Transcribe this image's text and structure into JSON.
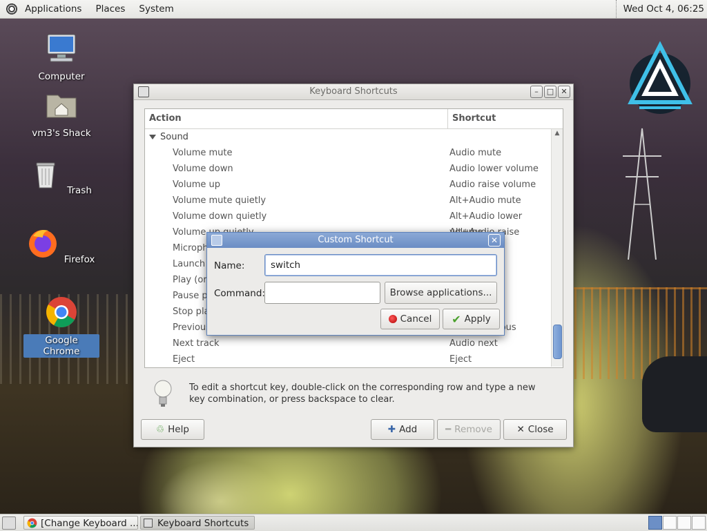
{
  "top_panel": {
    "menus": [
      "Applications",
      "Places",
      "System"
    ],
    "clock": "Wed Oct  4, 06:25"
  },
  "desktop_icons": [
    {
      "label": "Computer",
      "icon": "computer-icon"
    },
    {
      "label": "vm3's Shack",
      "icon": "home-folder-icon"
    },
    {
      "label": "Trash",
      "icon": "trash-icon"
    },
    {
      "label": "Firefox",
      "icon": "firefox-icon"
    },
    {
      "label": "Google Chrome",
      "icon": "chrome-icon"
    }
  ],
  "main_window": {
    "title": "Keyboard Shortcuts",
    "columns": {
      "action": "Action",
      "shortcut": "Shortcut"
    },
    "group": "Sound",
    "rows": [
      {
        "action": "Volume mute",
        "shortcut": "Audio mute"
      },
      {
        "action": "Volume down",
        "shortcut": "Audio lower volume"
      },
      {
        "action": "Volume up",
        "shortcut": "Audio raise volume"
      },
      {
        "action": "Volume mute quietly",
        "shortcut": "Alt+Audio mute"
      },
      {
        "action": "Volume down quietly",
        "shortcut": "Alt+Audio lower volume"
      },
      {
        "action": "Volume up quietly",
        "shortcut": "Alt+Audio raise volume"
      },
      {
        "action": "Microphone mute",
        "shortcut": ""
      },
      {
        "action": "Launch media player",
        "shortcut": ""
      },
      {
        "action": "Play (or play/pause)",
        "shortcut": ""
      },
      {
        "action": "Pause playback",
        "shortcut": ""
      },
      {
        "action": "Stop playback",
        "shortcut": ""
      },
      {
        "action": "Previous track",
        "shortcut": "Audio previous"
      },
      {
        "action": "Next track",
        "shortcut": "Audio next"
      },
      {
        "action": "Eject",
        "shortcut": "Eject"
      }
    ],
    "hint": "To edit a shortcut key, double-click on the corresponding row and type a new key combination, or press backspace to clear.",
    "buttons": {
      "help": "Help",
      "add": "Add",
      "remove": "Remove",
      "close": "Close"
    }
  },
  "dialog": {
    "title": "Custom Shortcut",
    "name_label": "Name:",
    "name_value": "switch",
    "command_label": "Command:",
    "command_value": "",
    "browse": "Browse applications...",
    "cancel": "Cancel",
    "apply": "Apply"
  },
  "taskbar": {
    "tasks": [
      "[Change Keyboard ...",
      "Keyboard Shortcuts"
    ]
  },
  "colors": {
    "selection": "#4a7bb8",
    "dialog_title": "#6b8dc4"
  }
}
